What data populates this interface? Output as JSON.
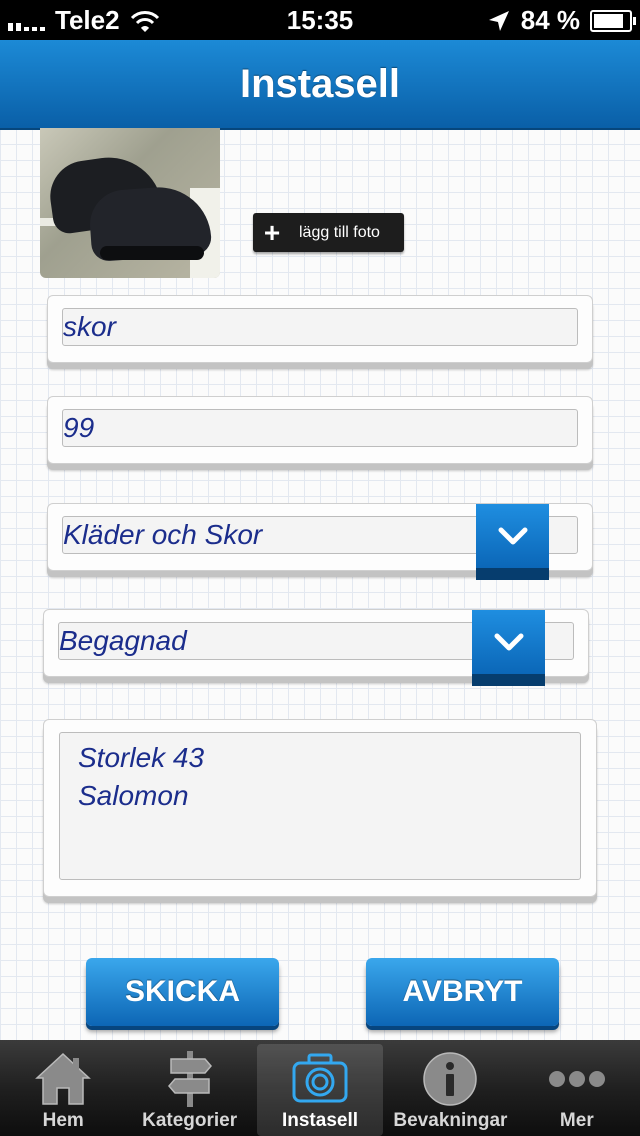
{
  "status_bar": {
    "carrier": "Tele2",
    "time": "15:35",
    "battery": "84 %",
    "battery_level": 0.84
  },
  "nav": {
    "title": "Instasell"
  },
  "photo": {
    "add_label": "lägg till foto"
  },
  "form": {
    "title_value": "skor",
    "price_value": "99",
    "category_value": "Kläder och Skor",
    "condition_value": "Begagnad",
    "description_value": "Storlek 43\nSalomon"
  },
  "buttons": {
    "submit": "SKICKA",
    "cancel": "AVBRYT"
  },
  "tabs": [
    {
      "label": "Hem",
      "icon": "home-icon"
    },
    {
      "label": "Kategorier",
      "icon": "signpost-icon"
    },
    {
      "label": "Instasell",
      "icon": "camera-icon",
      "active": true
    },
    {
      "label": "Bevakningar",
      "icon": "info-icon"
    },
    {
      "label": "Mer",
      "icon": "more-icon"
    }
  ],
  "colors": {
    "accent": "#0b67b8",
    "input_text": "#1b2d8c"
  }
}
